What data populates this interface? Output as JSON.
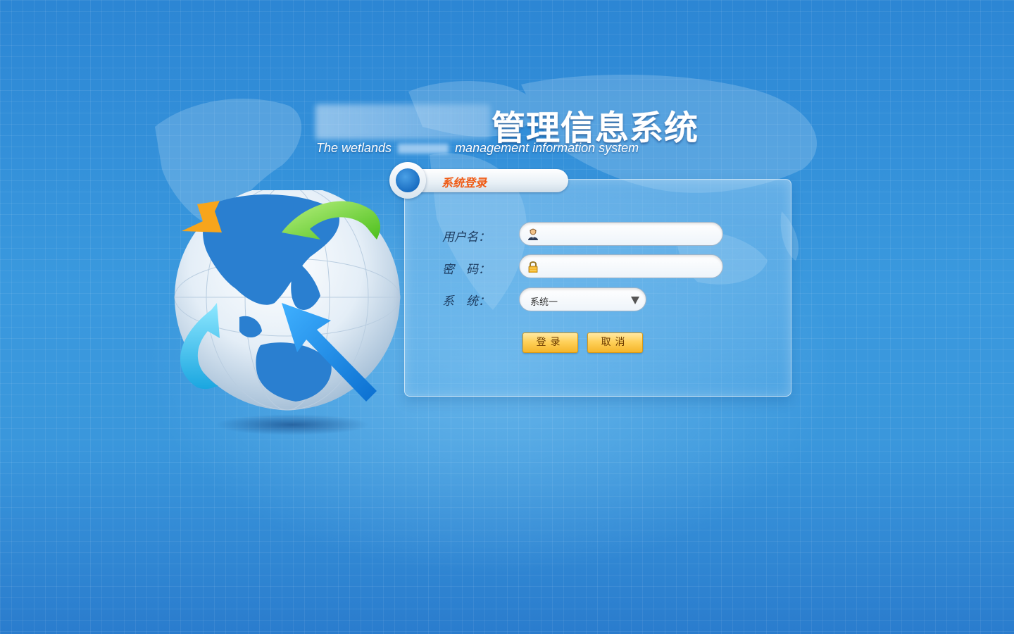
{
  "title": {
    "cn": "管理信息系统",
    "en_prefix": "The wetlands ",
    "en_suffix": " management information system"
  },
  "login": {
    "header": "系统登录",
    "username_label": "用户名：",
    "password_label": "密　码：",
    "system_label": "系　统：",
    "username_value": "",
    "password_value": "",
    "system_selected": "系统一",
    "login_button": "登录",
    "cancel_button": "取消"
  },
  "icons": {
    "username": "user-icon",
    "password": "lock-icon",
    "dropdown": "chevron-down-icon"
  },
  "colors": {
    "background": "#3a97dc",
    "header_text": "#ef5a14",
    "button": "#ffd15a"
  }
}
